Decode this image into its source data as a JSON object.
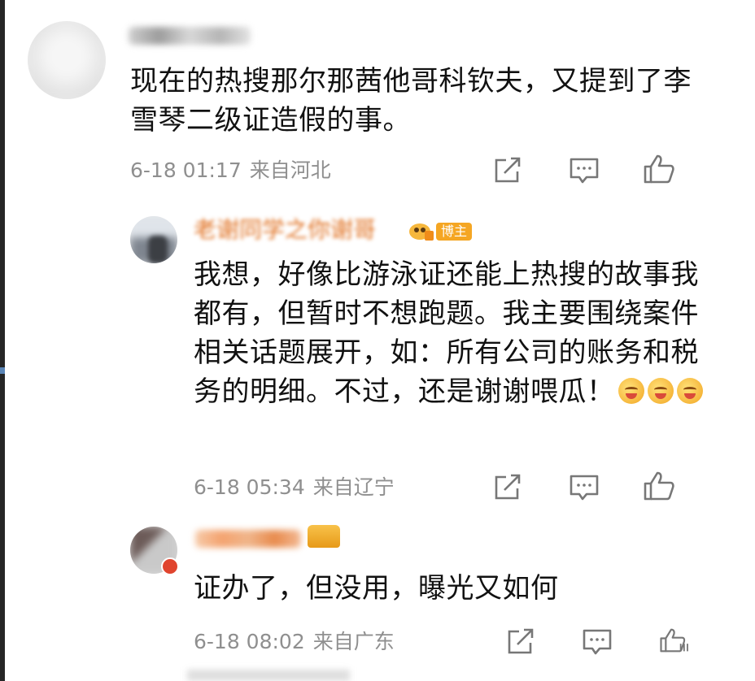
{
  "comments": [
    {
      "content": "现在的热搜那尔那茜他哥科钦夫，又提到了李雪琴二级证造假的事。",
      "time": "6-18 01:17",
      "location": "来自河北"
    },
    {
      "username": "老谢同学之你谢哥",
      "badge": "博主",
      "content": "我想，好像比游泳证还能上热搜的故事我都有，但暂时不想跑题。我主要围绕案件相关话题展开，如：所有公司的账务和税务的明细。不过，还是谢谢喂瓜！",
      "time": "6-18 05:34",
      "location": "来自辽宁"
    },
    {
      "content": "证办了，但没用，曝光又如何",
      "time": "6-18 08:02",
      "location": "来自广东"
    }
  ],
  "icons": {
    "share": "share-icon",
    "comment": "comment-icon",
    "like": "thumbs-up-icon"
  },
  "colors": {
    "username": "#e07020",
    "badge": "#f5a623",
    "meta": "#8f8f8f",
    "text": "#111111"
  }
}
